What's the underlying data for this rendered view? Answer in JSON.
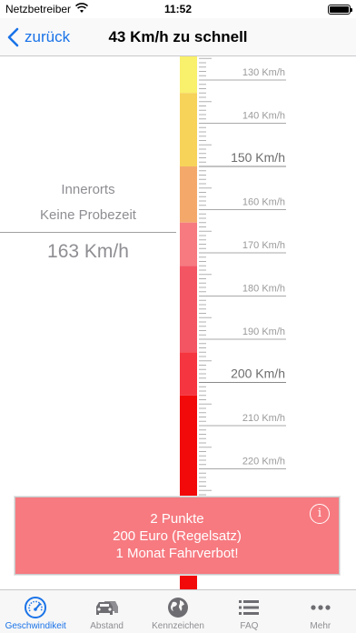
{
  "status_bar": {
    "carrier": "Netzbetreiber",
    "time": "11:52"
  },
  "nav": {
    "back_label": "zurück",
    "title": "43 Km/h zu schnell"
  },
  "info": {
    "location": "Innerorts",
    "probation": "Keine Probezeit",
    "speed": "163 Km/h"
  },
  "scale": {
    "colors": {
      "yellow": "#f9f06b",
      "yellow_orange": "#f7d35a",
      "light_orange": "#f4a96b",
      "pink": "#f67a80",
      "rose": "#f35563",
      "red_light": "#f5353f",
      "red": "#f20a0a"
    },
    "labels": [
      {
        "text": "130 Km/h",
        "value": 130,
        "major": false
      },
      {
        "text": "140 Km/h",
        "value": 140,
        "major": false
      },
      {
        "text": "150 Km/h",
        "value": 150,
        "major": true
      },
      {
        "text": "160 Km/h",
        "value": 160,
        "major": false
      },
      {
        "text": "170 Km/h",
        "value": 170,
        "major": false
      },
      {
        "text": "180 Km/h",
        "value": 180,
        "major": false
      },
      {
        "text": "190 Km/h",
        "value": 190,
        "major": false
      },
      {
        "text": "200 Km/h",
        "value": 200,
        "major": true
      },
      {
        "text": "210 Km/h",
        "value": 210,
        "major": false
      },
      {
        "text": "220 Km/h",
        "value": 220,
        "major": false
      }
    ]
  },
  "result": {
    "points": "2 Punkte",
    "fine": "200 Euro (Regelsatz)",
    "ban": "1 Monat Fahrverbot!"
  },
  "tabs": [
    {
      "label": "Geschwindikeit",
      "icon": "speedometer-icon",
      "active": true
    },
    {
      "label": "Abstand",
      "icon": "cars-icon",
      "active": false
    },
    {
      "label": "Kennzeichen",
      "icon": "globe-icon",
      "active": false
    },
    {
      "label": "FAQ",
      "icon": "list-icon",
      "active": false
    },
    {
      "label": "Mehr",
      "icon": "more-dots-icon",
      "active": false
    }
  ],
  "accent_color": "#1a73e8"
}
